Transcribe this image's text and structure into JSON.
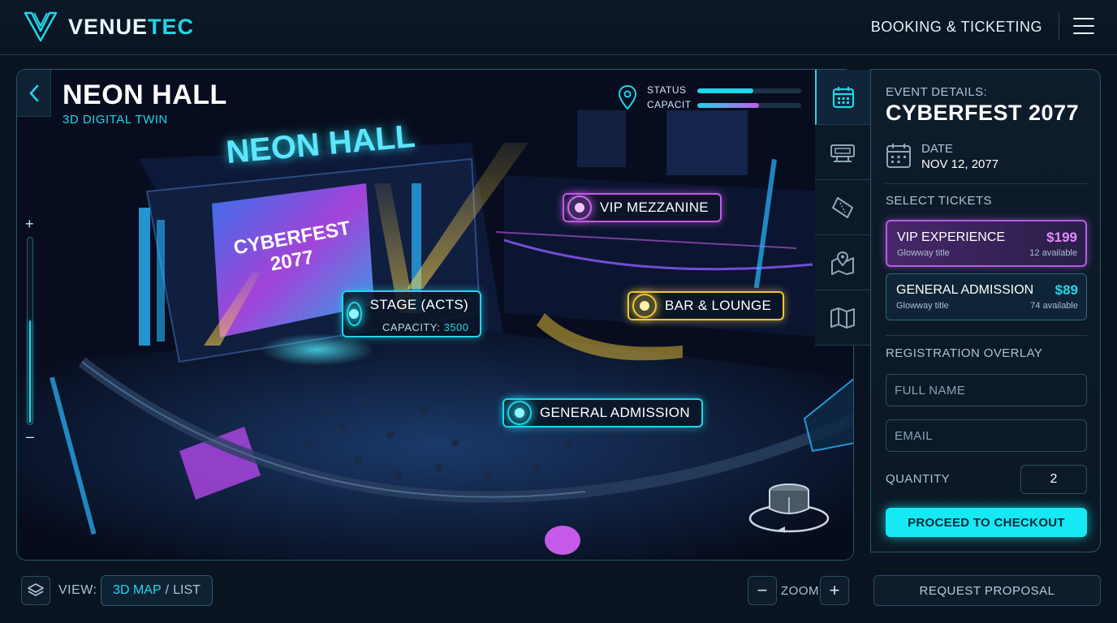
{
  "brand": {
    "name_main": "VENUE",
    "name_accent": "TEC"
  },
  "header": {
    "nav_title": "BOOKING & TICKETING",
    "menu_icon": "hamburger-menu-icon"
  },
  "venue": {
    "title": "NEON HALL",
    "subtitle": "3D DIGITAL TWIN",
    "status": {
      "status_label": "STATUS",
      "status_level": 0.54,
      "capacity_label": "CAPACIT",
      "capacity_level": 0.59
    },
    "zoom_slider_level": 0.55,
    "scene_text": {
      "sign": "NEON HALL",
      "screen_line1": "CYBERFEST",
      "screen_line2": "2077"
    },
    "hotspots": {
      "vip": {
        "label": "VIP MEZZANINE",
        "color": "#c55ae8"
      },
      "stage": {
        "label": "STAGE (ACTS)",
        "capacity_label": "CAPACITY:",
        "capacity_value": "3500",
        "color": "#1fd6e8"
      },
      "bar": {
        "label": "BAR & LOUNGE",
        "color": "#f0c63a"
      },
      "ga": {
        "label": "GENERAL ADMISSION",
        "color": "#1fd6e8"
      }
    }
  },
  "rail": {
    "items": [
      "calendar-icon",
      "ticket-scanner-icon",
      "ticket-icon",
      "map-pin-icon",
      "map-icon"
    ],
    "active": 0
  },
  "event": {
    "details_label": "EVENT DETAILS:",
    "name": "CYBERFEST 2077",
    "date_label": "DATE",
    "date_value": "NOV 12, 2077",
    "select_tickets_label": "SELECT TICKETS",
    "tickets": [
      {
        "name": "VIP EXPERIENCE",
        "sub": "Glowway title",
        "price": "$199",
        "available": "12 available",
        "price_color": "#e58cff"
      },
      {
        "name": "GENERAL ADMISSION",
        "sub": "Glowway title",
        "price": "$89",
        "available": "74 available",
        "price_color": "#1fd6e8"
      }
    ],
    "registration_label": "REGISTRATION OVERLAY",
    "full_name": {
      "value": "",
      "placeholder": "FULL NAME"
    },
    "email": {
      "value": "",
      "placeholder": "EMAIL"
    },
    "quantity_label": "QUANTITY",
    "quantity_value": "2",
    "checkout_label": "PROCEED TO CHECKOUT"
  },
  "footer": {
    "view_label": "VIEW:",
    "view_3d": "3D MAP",
    "view_sep": "/",
    "view_list": "LIST",
    "zoom_label": "ZOOM",
    "zoom_out": "−",
    "zoom_in": "+",
    "proposal_label": "REQUEST PROPOSAL"
  }
}
